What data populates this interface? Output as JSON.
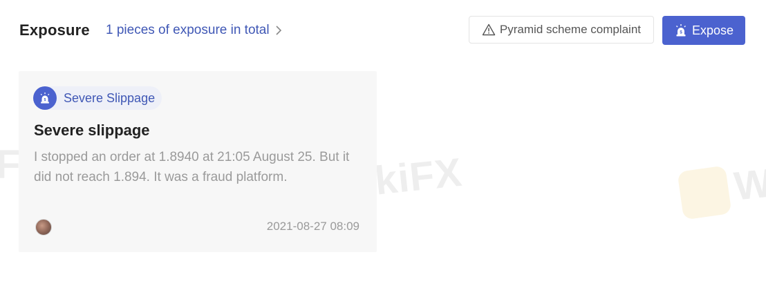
{
  "header": {
    "title": "Exposure",
    "count_text": "1 pieces of exposure in total",
    "complaint_button": "Pyramid scheme complaint",
    "expose_button": "Expose"
  },
  "card": {
    "tag_label": "Severe Slippage",
    "title": "Severe slippage",
    "body": "I stopped an order at 1.8940 at 21:05 August 25. But it did not reach 1.894. It was a fraud platform.",
    "date": "2021-08-27 08:09"
  },
  "watermark": {
    "text_left": "FX",
    "text_center": "WikiFX",
    "text_right": "W"
  },
  "colors": {
    "accent": "#4b62cf",
    "link": "#3f57b5",
    "muted": "#9a9a9a"
  },
  "icons": {
    "chevron": "chevron-right-icon",
    "warning": "warning-triangle-icon",
    "alarm": "alarm-icon",
    "avatar": "user-avatar"
  }
}
